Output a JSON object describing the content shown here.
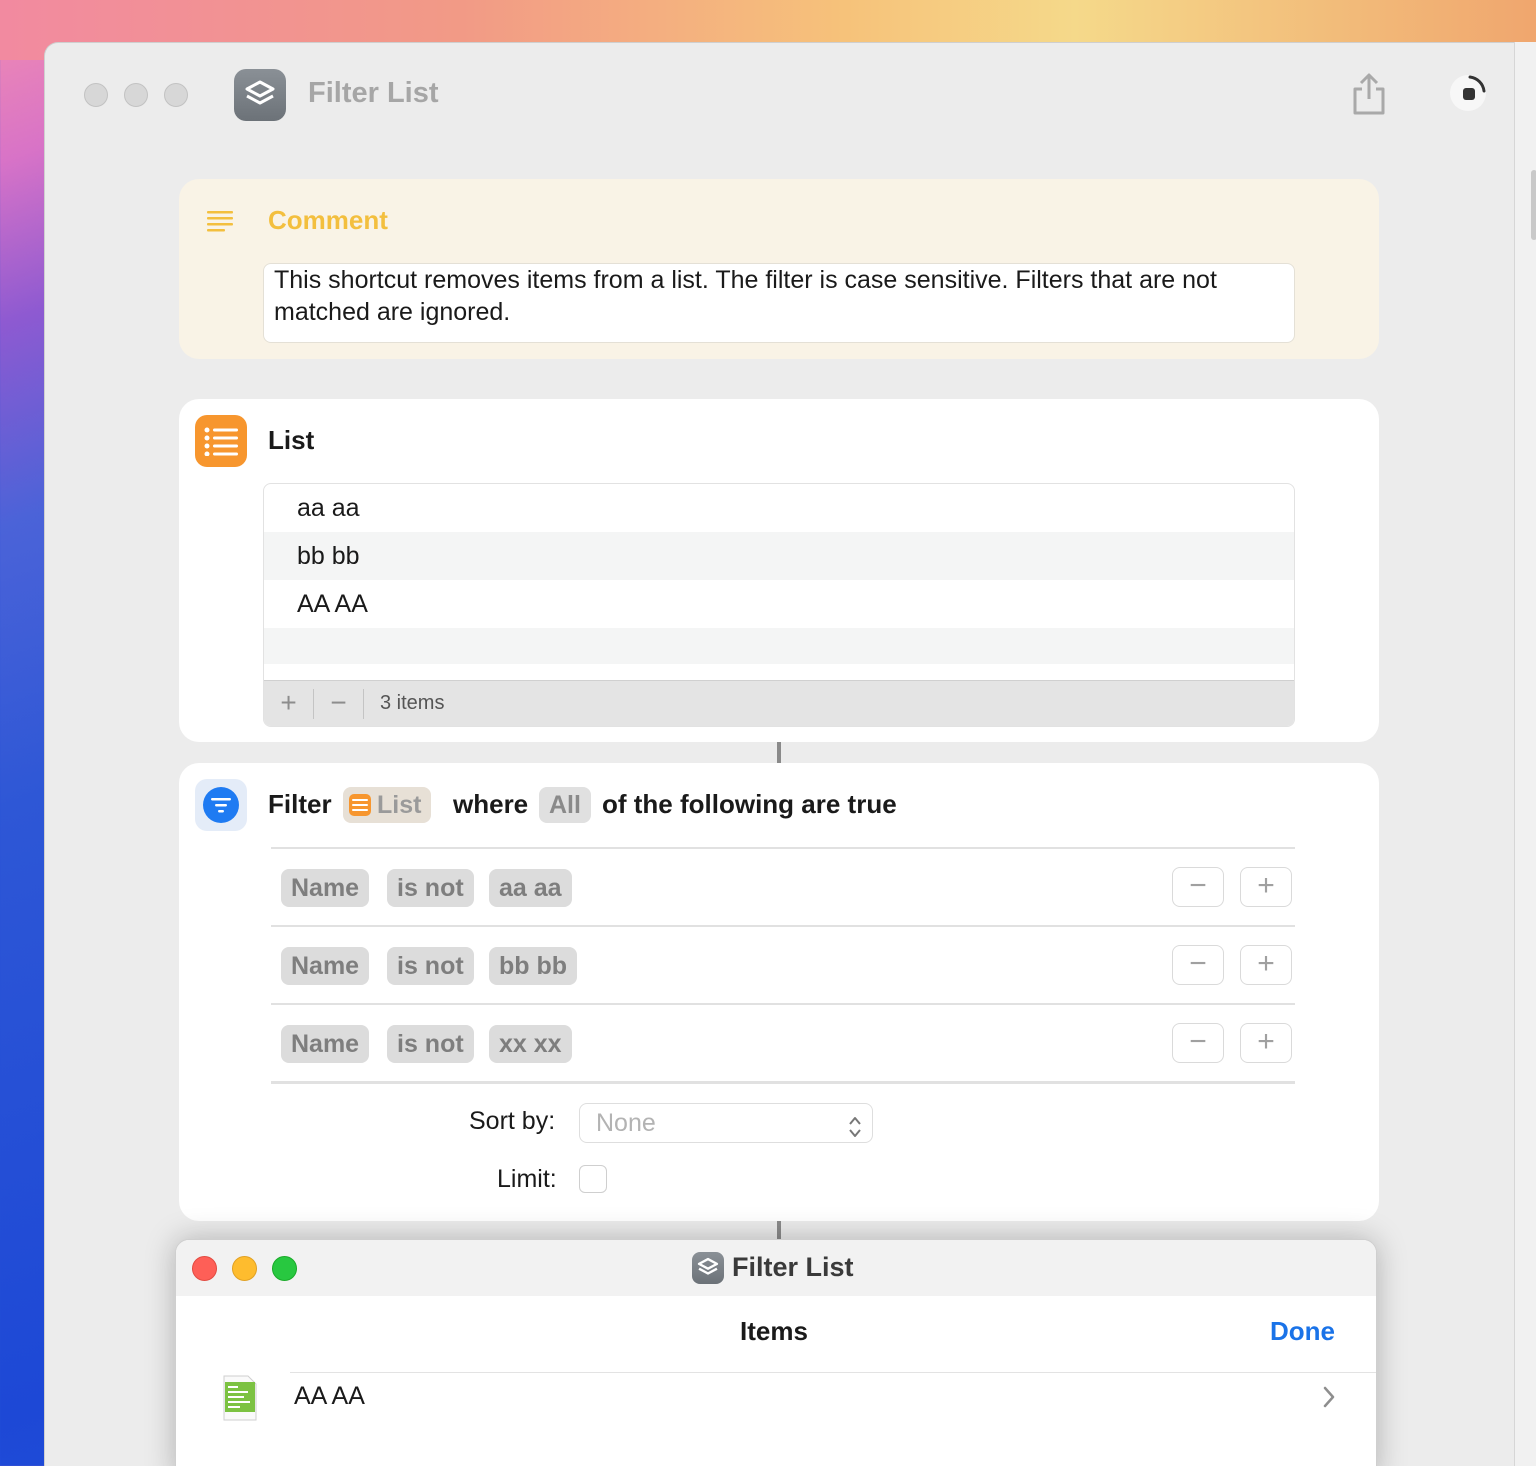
{
  "window": {
    "title": "Filter List"
  },
  "comment": {
    "title": "Comment",
    "text": "This shortcut removes items from a list. The filter is case sensitive. Filters that are not matched are ignored."
  },
  "list_action": {
    "title": "List",
    "items": [
      "aa aa",
      "bb bb",
      "AA AA"
    ],
    "add_label": "+",
    "remove_label": "−",
    "count_label": "3 items"
  },
  "filter_action": {
    "filter_label": "Filter",
    "input_token": "List",
    "where_label": "where",
    "mode_token": "All",
    "following_label": "of the following are true",
    "conditions": [
      {
        "property": "Name",
        "operator": "is not",
        "value": "aa aa"
      },
      {
        "property": "Name",
        "operator": "is not",
        "value": "bb bb"
      },
      {
        "property": "Name",
        "operator": "is not",
        "value": "xx xx"
      }
    ],
    "minus_label": "−",
    "plus_label": "+",
    "sort_label": "Sort by:",
    "sort_value": "None",
    "limit_label": "Limit:",
    "limit_checked": false
  },
  "result_window": {
    "title": "Filter List",
    "header": "Items",
    "done_label": "Done",
    "items": [
      {
        "label": "AA AA",
        "icon": "text-file-icon"
      }
    ]
  },
  "colors": {
    "comment_accent": "#f3bf3e",
    "list_icon": "#f7962e",
    "filter_icon": "#1f7bf2",
    "done_link": "#1a73e8",
    "close": "#fe5f57",
    "minimize": "#febc2e",
    "zoom": "#28c840"
  }
}
